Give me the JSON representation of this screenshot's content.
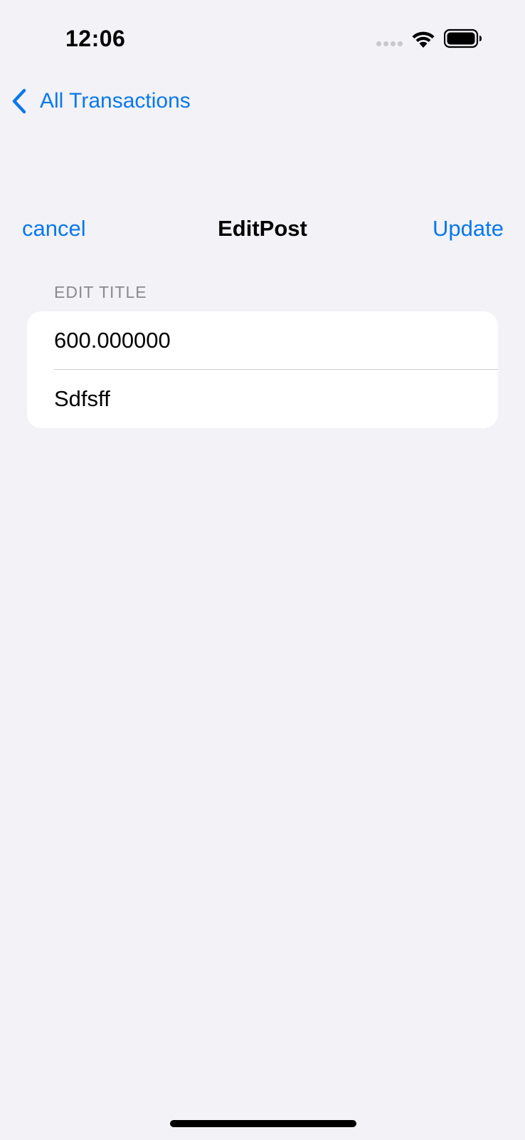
{
  "status_bar": {
    "time": "12:06",
    "icons": [
      "signal-dots-icon",
      "wifi-icon",
      "battery-icon"
    ]
  },
  "nav": {
    "back_icon": "chevron-left-icon",
    "back_label": "All Transactions"
  },
  "sheet": {
    "cancel_label": "cancel",
    "title": "EditPost",
    "update_label": "Update"
  },
  "form": {
    "section_header": "EDIT TITLE",
    "amount_value": "600.000000",
    "title_value": "Sdfsff"
  },
  "colors": {
    "accent": "#0A78E8",
    "background": "#F2F2F7",
    "card": "#FFFFFF",
    "secondary_text": "#8A8A8E"
  }
}
